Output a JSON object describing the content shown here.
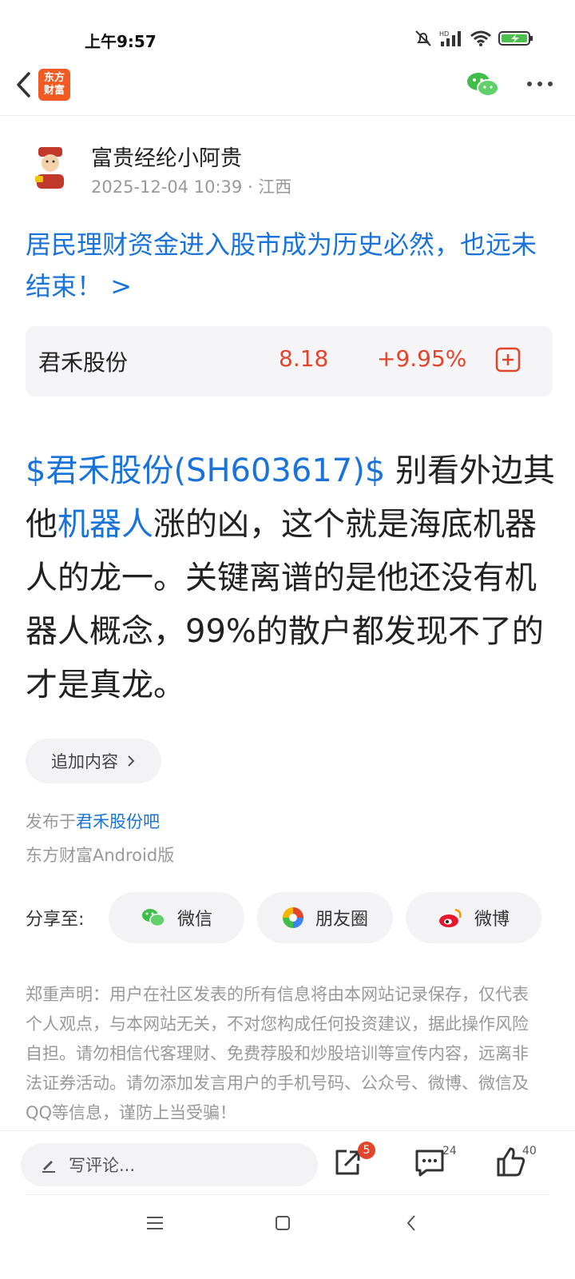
{
  "status_bar": {
    "time": "上午9:57"
  },
  "nav": {
    "logo_line1": "东方",
    "logo_line2": "财富"
  },
  "author": {
    "name": "富贵经纶小阿贵",
    "datetime": "2025-12-04 10:39",
    "location": "· 江西"
  },
  "post": {
    "title": "居民理财资金进入股市成为历史必然，也远未结束！",
    "title_arrow": ">",
    "body_link1": "$君禾股份(SH603617)$",
    "body_text1": " 别看外边其他",
    "body_link2": "机器人",
    "body_text2": "涨的凶，这个就是海底机器人的龙一。关键离谱的是他还没有机器人概念，99%的散户都发现不了的才是真龙。"
  },
  "stock": {
    "name": "君禾股份",
    "price": "8.18",
    "change": "+9.95%"
  },
  "append_label": "追加内容",
  "published": {
    "prefix": "发布于",
    "forum": "君禾股份吧",
    "platform": "东方财富Android版"
  },
  "share": {
    "label": "分享至:",
    "wechat": "微信",
    "moments": "朋友圈",
    "weibo": "微博"
  },
  "disclaimer": "郑重声明：用户在社区发表的所有信息将由本网站记录保存，仅代表个人观点，与本网站无关，不对您构成任何投资建议，据此操作风险自担。请勿相信代客理财、免费荐股和炒股培训等宣传内容，远离非法证券活动。请勿添加发言用户的手机号码、公众号、微博、微信及QQ等信息，谨防上当受骗！",
  "bottom_bar": {
    "comment_placeholder": "写评论...",
    "share_badge": "5",
    "comment_count": "24",
    "like_count": "40"
  },
  "colors": {
    "link": "#1a73d9",
    "rise": "#e2452b",
    "brand": "#f15a22"
  }
}
